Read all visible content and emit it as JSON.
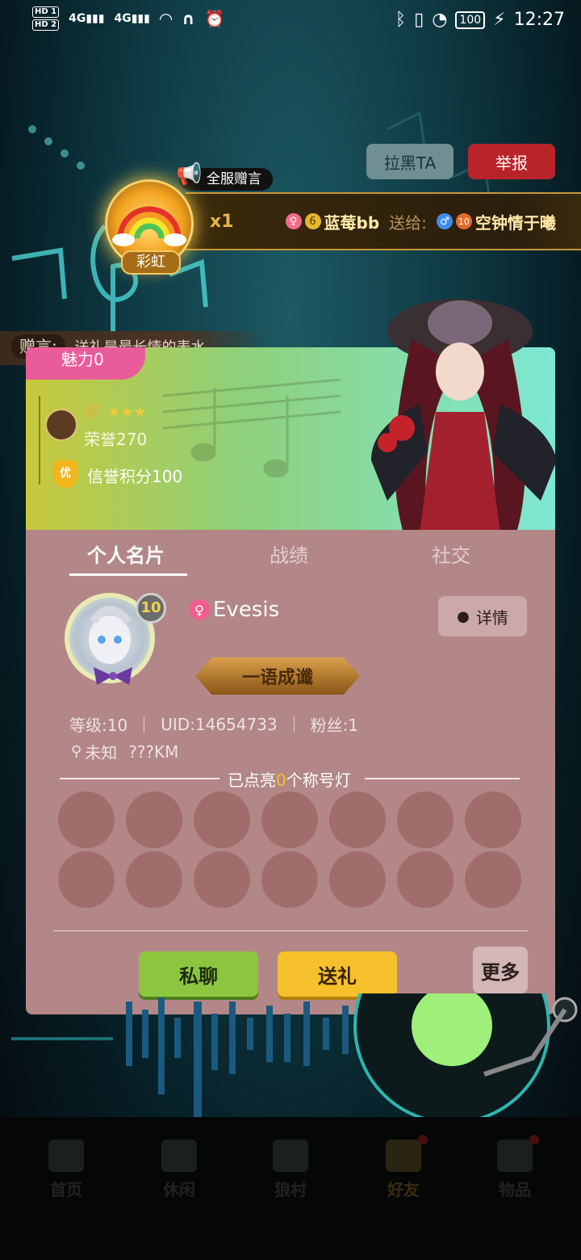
{
  "status_bar": {
    "hd1": "HD 1",
    "hd2": "HD 2",
    "signal1": "4G",
    "signal2": "4G",
    "battery": "100",
    "time": "12:27"
  },
  "top_actions": {
    "block_label": "拉黑TA",
    "report_label": "举报"
  },
  "gift_banner": {
    "tag": "全服赠言",
    "gift_name": "彩虹",
    "count": "x1",
    "sender_level": "6",
    "sender": "蓝莓bb",
    "sent_to": "送给:",
    "receiver_level": "10",
    "receiver": "空钟情于曦"
  },
  "gift_message": {
    "label": "赠言:",
    "text": "送礼是最长情的表水"
  },
  "profile_top": {
    "charm": "魅力0",
    "rank": "I阶",
    "stars": "★★★",
    "honor_label": "荣誉",
    "honor_value": "270",
    "credit_badge": "优",
    "credit_text": "信誉积分100"
  },
  "tabs": [
    "个人名片",
    "战绩",
    "社交"
  ],
  "profile": {
    "avatar_level": "10",
    "name": "Evesis",
    "details_label": "详情",
    "title_badge": "一语成谶",
    "level": "等级:10",
    "uid": "UID:14654733",
    "fans": "粉丝:1",
    "location": "未知",
    "distance": "???KM",
    "lights_prefix": "已点亮",
    "lights_count": "0",
    "lights_suffix": "个称号灯"
  },
  "actions": {
    "chat": "私聊",
    "gift": "送礼",
    "more": "更多"
  },
  "bottom_nav": [
    "首页",
    "休闲",
    "狼村",
    "好友",
    "物品"
  ],
  "colors": {
    "accent_red": "#c0282d",
    "chat_green": "#8cc63f",
    "gift_yellow": "#f5c02b",
    "card_bg": "#b38787"
  }
}
